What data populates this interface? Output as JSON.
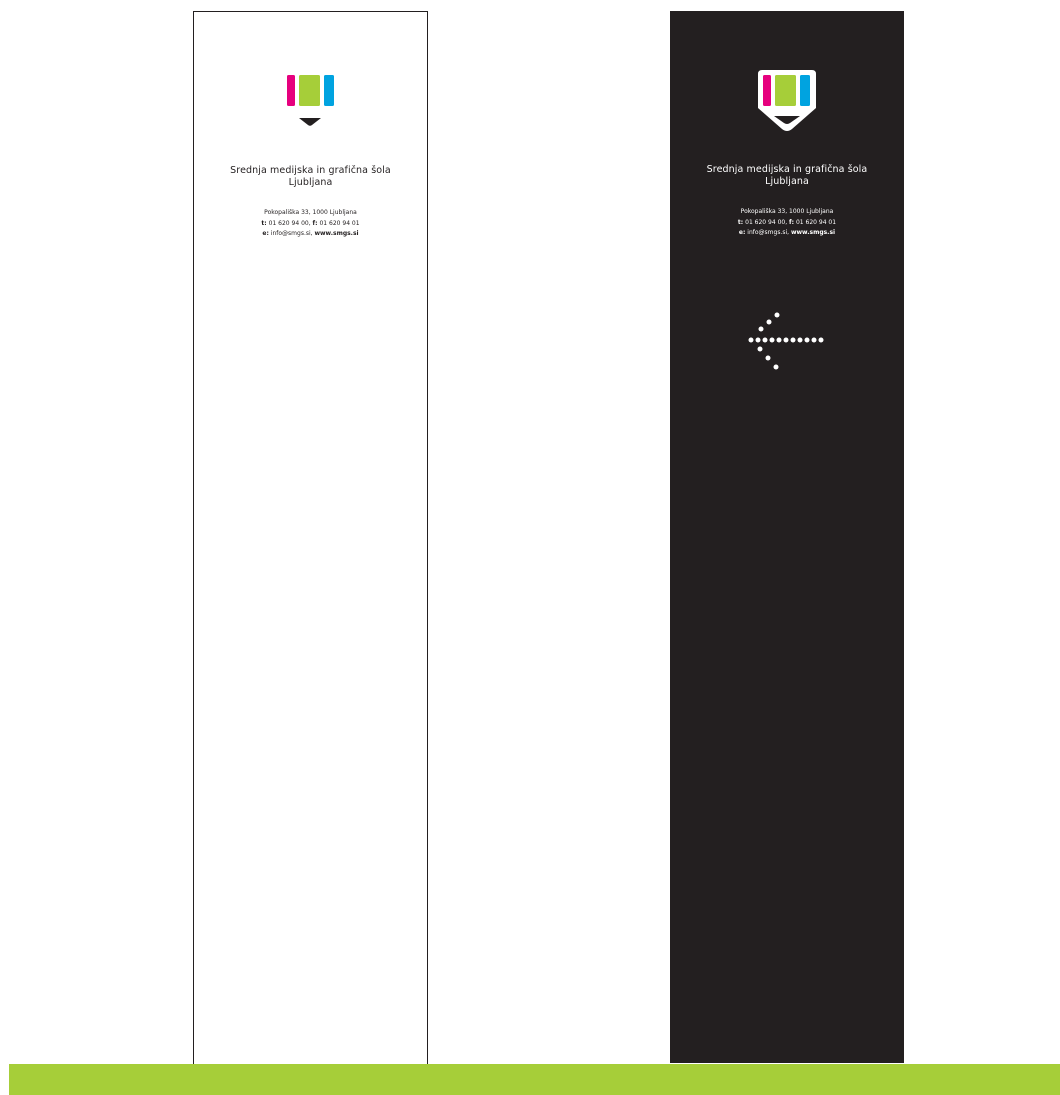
{
  "colors": {
    "magenta": "#e6007e",
    "green": "#a6ce39",
    "cyan": "#00a3e0",
    "dark": "#231f20",
    "bar": "#a6ce39"
  },
  "panels": {
    "white": {
      "school_name_line1": "Srednja medijska in grafična šola",
      "school_name_line2": "Ljubljana",
      "address": "Pokopališka 33, 1000 Ljubljana",
      "phone_label": "t:",
      "phone": "01 620 94 00,",
      "fax_label": "f:",
      "fax": "01 620 94 01",
      "email_label": "e:",
      "email": "info@smgs.si,",
      "web": "www.smgs.si"
    },
    "dark": {
      "school_name_line1": "Srednja medijska in grafična šola",
      "school_name_line2": "Ljubljana",
      "address": "Pokopališka 33, 1000 Ljubljana",
      "phone_label": "t:",
      "phone": "01 620 94 00,",
      "fax_label": "f:",
      "fax": "01 620 94 01",
      "email_label": "e:",
      "email": "info@smgs.si,",
      "web": "www.smgs.si",
      "arrow_icon": "dotted-arrow-left-icon"
    }
  }
}
